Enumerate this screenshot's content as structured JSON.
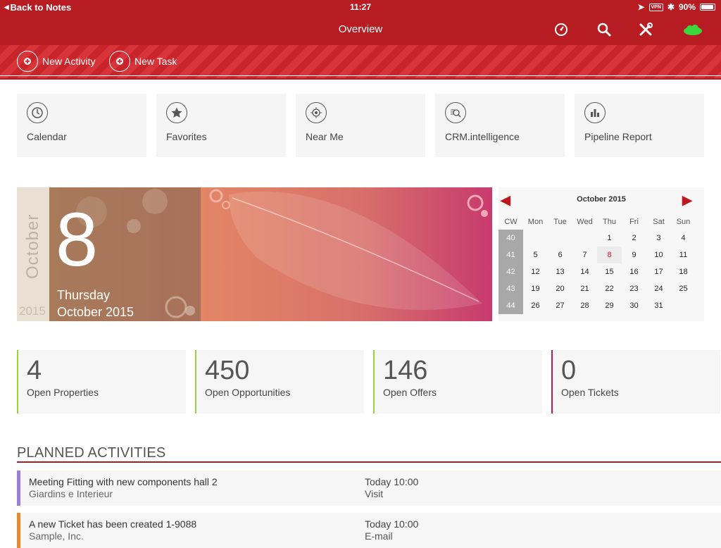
{
  "status": {
    "back_label": "Back to Notes",
    "time": "11:27",
    "vpn": "VPN",
    "battery": "90%"
  },
  "header": {
    "title": "Overview"
  },
  "actions": {
    "new_activity": "New Activity",
    "new_task": "New Task"
  },
  "tiles": [
    {
      "label": "Calendar",
      "icon": "clock-icon"
    },
    {
      "label": "Favorites",
      "icon": "star-icon"
    },
    {
      "label": "Near Me",
      "icon": "location-icon"
    },
    {
      "label": "CRM.intelligence",
      "icon": "analytics-icon"
    },
    {
      "label": "Pipeline Report",
      "icon": "bar-chart-icon"
    }
  ],
  "banner": {
    "month_vertical": "October",
    "year": "2015",
    "day": "8",
    "weekday": "Thursday",
    "month_year": "October 2015"
  },
  "calendar": {
    "title": "October 2015",
    "headers": [
      "CW",
      "Mon",
      "Tue",
      "Wed",
      "Thu",
      "Fri",
      "Sat",
      "Sun"
    ],
    "today": "8",
    "weeks": [
      [
        "40",
        "",
        "",
        "",
        "1",
        "2",
        "3",
        "4"
      ],
      [
        "41",
        "5",
        "6",
        "7",
        "8",
        "9",
        "10",
        "11"
      ],
      [
        "42",
        "12",
        "13",
        "14",
        "15",
        "16",
        "17",
        "18"
      ],
      [
        "43",
        "19",
        "20",
        "21",
        "22",
        "23",
        "24",
        "25"
      ],
      [
        "44",
        "26",
        "27",
        "28",
        "29",
        "30",
        "31",
        ""
      ]
    ]
  },
  "kpis": [
    {
      "value": "4",
      "label": "Open Properties"
    },
    {
      "value": "450",
      "label": "Open Opportunities"
    },
    {
      "value": "146",
      "label": "Open Offers"
    },
    {
      "value": "0",
      "label": "Open Tickets"
    }
  ],
  "planned": {
    "title": "PLANNED ACTIVITIES",
    "items": [
      {
        "title": "Meeting Fitting with new components hall 2",
        "company": "Giardins e Interieur",
        "when": "Today 10:00",
        "type": "Visit",
        "color": "#9b7fd6"
      },
      {
        "title": "A new Ticket has been created 1-9088",
        "company": "Sample, Inc.",
        "when": "Today 10:00",
        "type": "E-mail",
        "color": "#e38a36"
      }
    ]
  },
  "colors": {
    "brand": "#b71c22",
    "kpi_green": "#9ccf44",
    "kpi_red": "#c2185b",
    "sync_green": "#3bd63b"
  }
}
